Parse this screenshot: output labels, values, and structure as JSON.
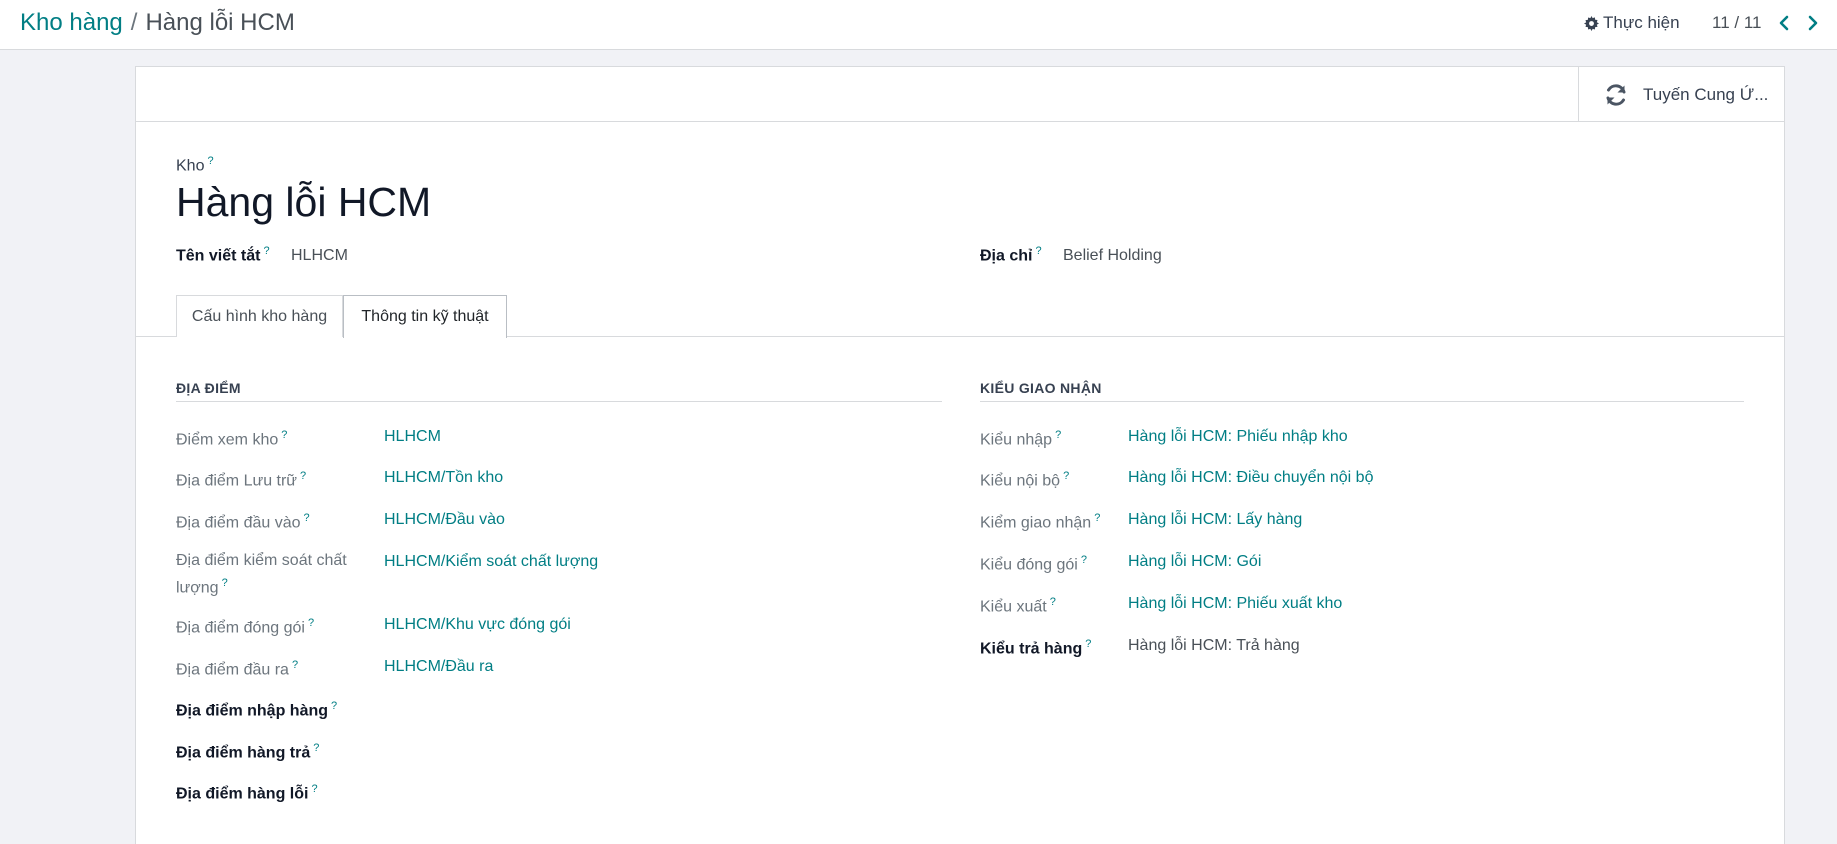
{
  "breadcrumb": {
    "parent": "Kho hàng",
    "separator": "/",
    "current": "Hàng lỗi HCM"
  },
  "action_menu": {
    "label": "Thực hiện",
    "icon": "gear-icon"
  },
  "pager": {
    "value": "11 / 11",
    "prev_icon": "chevron-left-icon",
    "next_icon": "chevron-right-icon"
  },
  "smart_button": {
    "label": "Tuyến Cung Ứ...",
    "icon": "refresh-icon"
  },
  "form": {
    "field_label": "Kho",
    "help_mark": "?",
    "name": "Hàng lỗi HCM",
    "short_name_label": "Tên viết tắt",
    "short_name_value": "HLHCM",
    "address_label": "Địa chỉ",
    "address_value": "Belief Holding"
  },
  "tabs": [
    {
      "label": "Cấu hình kho hàng",
      "active": false
    },
    {
      "label": "Thông tin kỹ thuật",
      "active": true
    }
  ],
  "locations": {
    "title": "ĐỊA ĐIỂM",
    "rows": [
      {
        "label": "Điểm xem kho",
        "value": "HLHCM"
      },
      {
        "label": "Địa điểm Lưu trữ",
        "value": "HLHCM/Tồn kho"
      },
      {
        "label": "Địa điểm đầu vào",
        "value": "HLHCM/Đầu vào"
      },
      {
        "label": "Địa điểm kiểm soát chất lượng",
        "value": "HLHCM/Kiểm soát chất lượng"
      },
      {
        "label": "Địa điểm đóng gói",
        "value": "HLHCM/Khu vực đóng gói"
      },
      {
        "label": "Địa điểm đầu ra",
        "value": "HLHCM/Đầu ra"
      },
      {
        "label": "Địa điểm nhập hàng",
        "value": ""
      },
      {
        "label": "Địa điểm hàng trả",
        "value": ""
      },
      {
        "label": "Địa điểm hàng lỗi",
        "value": ""
      }
    ]
  },
  "operation_types": {
    "title": "KIỂU GIAO NHẬN",
    "rows": [
      {
        "label": "Kiểu nhập",
        "value": "Hàng lỗi HCM: Phiếu nhập kho"
      },
      {
        "label": "Kiểu nội bộ",
        "value": "Hàng lỗi HCM: Điều chuyển nội bộ"
      },
      {
        "label": "Kiểm giao nhận",
        "value": "Hàng lỗi HCM: Lấy hàng"
      },
      {
        "label": "Kiểu đóng gói",
        "value": "Hàng lỗi HCM: Gói"
      },
      {
        "label": "Kiểu xuất",
        "value": "Hàng lỗi HCM: Phiếu xuất kho"
      },
      {
        "label": "Kiểu trả hàng",
        "value": "Hàng lỗi HCM: Trả hàng"
      }
    ]
  },
  "colors": {
    "accent": "#017e84",
    "background": "#f1f2f6",
    "border": "#d8dadd"
  }
}
